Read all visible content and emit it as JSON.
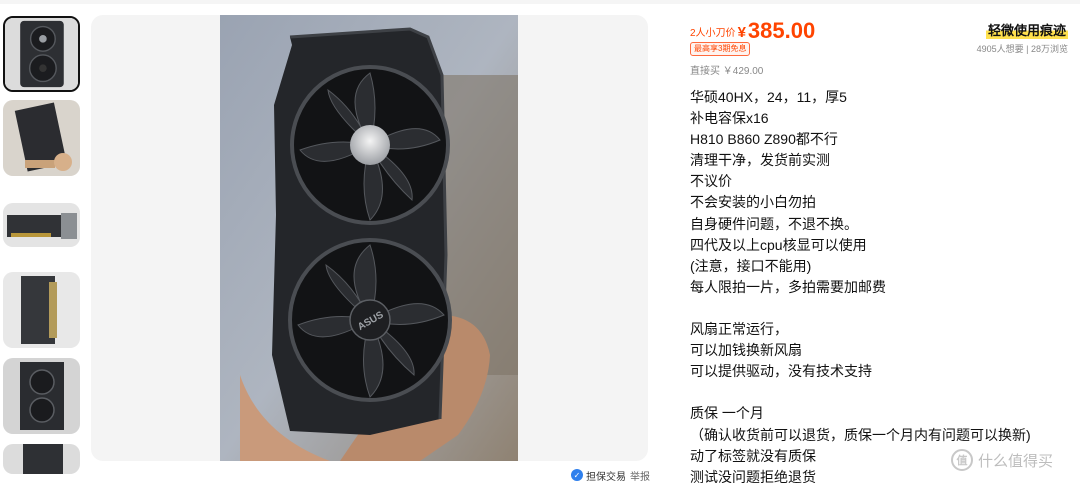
{
  "listing": {
    "cut_label": "2人小刀价",
    "currency": "¥",
    "price": "385.00",
    "installment_badge": "最高享3期免息",
    "direct_buy": "直接买 ￥429.00",
    "condition": "轻微使用痕迹",
    "stats": "4905人想要 | 28万浏览"
  },
  "description": [
    "华硕40HX，24，11，厚5",
    "补电容保x16",
    "H810 B860 Z890都不行",
    "清理干净，发货前实测",
    "不议价",
    "不会安装的小白勿拍",
    "自身硬件问题，不退不换。",
    "四代及以上cpu核显可以使用",
    "(注意，接口不能用)",
    "每人限拍一片，多拍需要加邮费",
    "",
    "风扇正常运行，",
    "可以加钱换新风扇",
    "可以提供驱动，没有技术支持",
    "",
    "质保 一个月",
    "（确认收货前可以退货，质保一个月内有问题可以换新)",
    "动了标签就没有质保",
    "测试没问题拒绝退货"
  ],
  "image_footer": {
    "guarantee_label": "担保交易",
    "report_label": "举报"
  },
  "watermark": "值 什么值得买",
  "colors": {
    "price": "#ff4400",
    "condition_highlight": "#ffe14d",
    "guarantee_icon": "#2f80ed"
  }
}
